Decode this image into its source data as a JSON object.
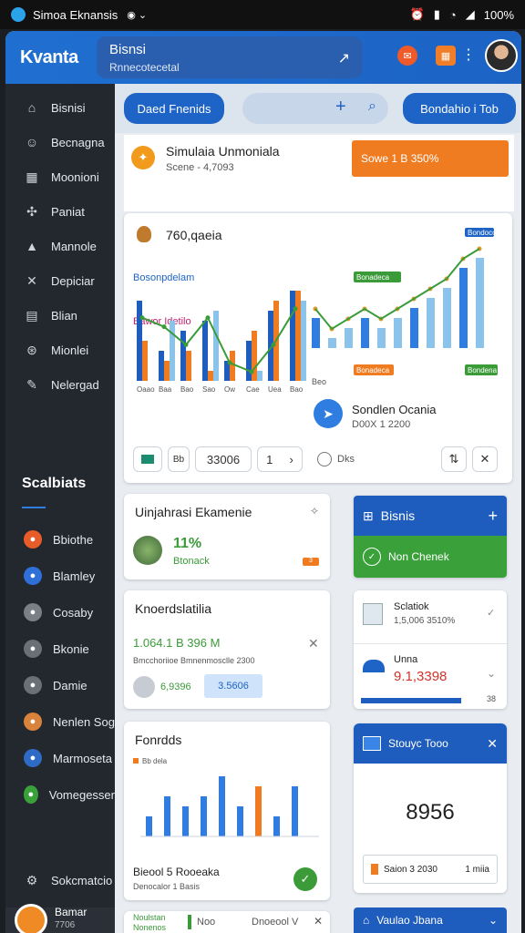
{
  "status": {
    "app": "Simoa Eknansis",
    "battery": "100%"
  },
  "header": {
    "brand": "Kvanta",
    "title": "Bisnsi",
    "subtitle": "Rnnecotecetal"
  },
  "sidebar": {
    "items": [
      {
        "label": "Bisnisi",
        "icon": "home-icon"
      },
      {
        "label": "Becnagna",
        "icon": "user-icon"
      },
      {
        "label": "Moonioni",
        "icon": "grid-icon"
      },
      {
        "label": "Paniat",
        "icon": "puzzle-icon"
      },
      {
        "label": "Mannole",
        "icon": "chart-icon"
      },
      {
        "label": "Depiciar",
        "icon": "tools-icon"
      },
      {
        "label": "Blian",
        "icon": "calendar-icon"
      },
      {
        "label": "Mionlei",
        "icon": "settings-icon"
      },
      {
        "label": "Nelergad",
        "icon": "edit-icon"
      }
    ],
    "section_title": "Scalbiats",
    "accounts": [
      {
        "label": "Bbiothe",
        "color": "#e85c2a"
      },
      {
        "label": "Blamley",
        "color": "#2f6fd8"
      },
      {
        "label": "Cosaby",
        "color": "#7a7f88"
      },
      {
        "label": "Bkonie",
        "color": "#6b7077"
      },
      {
        "label": "Damie",
        "color": "#6b7077"
      },
      {
        "label": "Nenlen Sog",
        "color": "#d9823b"
      },
      {
        "label": "Marmoseta",
        "color": "#2d6bc4"
      },
      {
        "label": "Vomegesser",
        "color": "#3aa03a"
      }
    ],
    "settings_label": "Sokcmatcio",
    "profile": {
      "name": "Bamar",
      "sub": "7706"
    }
  },
  "toolbar": {
    "button": "Daed Fnenids",
    "profile_button": "Bondahio i Tob"
  },
  "summary": {
    "title": "Simulaia Unmoniala",
    "sub": "Scene - 4,7093",
    "badge": "Sowe 1 B 350%"
  },
  "main_chart": {
    "title": "760,qaeia",
    "label_series1": "Bosonpdelam",
    "label_series2": "Bawor Idetilo",
    "label_tag1": "Bondoco",
    "label_tag2": "Bonadeca",
    "label_tag3": "Bonadeca",
    "label_tag4": "Bondena",
    "footer_label": "Beo",
    "insight_title": "Sondlen Ocania",
    "insight_sub": "D00X 1 2200",
    "input_value": "33006",
    "page": "1",
    "radio_label": "Dks"
  },
  "chart_data": {
    "type": "bar",
    "categories": [
      "Oaao",
      "Baa",
      "Bao",
      "Sao",
      "Ow",
      "Cae",
      "Uea",
      "Bao"
    ],
    "series": [
      {
        "values": [
          8,
          3,
          5,
          6,
          2,
          4,
          7,
          9
        ]
      },
      {
        "values": [
          4,
          2,
          3,
          1,
          3,
          5,
          8,
          9
        ]
      },
      {
        "values": [
          7,
          6,
          4,
          7,
          2,
          1,
          4,
          8
        ]
      }
    ],
    "right_values": [
      3,
      1,
      2,
      3,
      2,
      3,
      4,
      5,
      6,
      8,
      9
    ]
  },
  "card_universal": {
    "title": "Uinjahrasi Ekamenie",
    "value": "11%",
    "sub": "Btonack",
    "tag": "3"
  },
  "card_klient": {
    "title": "Knoerdslatilia",
    "value": "1.064.1 B 396 M",
    "sub": "Bmcchoriioe Bmnenmosclle 2300",
    "v1": "6,9396",
    "v2": "3.5606"
  },
  "card_furnds": {
    "title": "Fonrdds",
    "legend": "Bb dela",
    "footer_title": "Bieool 5 Rooeaka",
    "footer_sub": "Denocalor 1 Basis"
  },
  "bottom_bar": {
    "l1": "Noulstan",
    "l2": "Nonenos",
    "tag": "Noo",
    "right": "Dnoeool V"
  },
  "right_cards": {
    "bisnis": {
      "title": "Bisnis"
    },
    "new": {
      "label": "Non Chenek"
    },
    "stats": {
      "title": "Sclatiok",
      "value": "1,5,006 3510%"
    },
    "unit": {
      "title": "Unna",
      "value": "9.1,3398",
      "corner": "38"
    },
    "big": {
      "title": "Stouyc Tooo",
      "value": "8956",
      "chip": "Saion 3 2030",
      "chip2": "1 miia"
    },
    "bottom": {
      "title": "Vaulao Jbana"
    }
  }
}
